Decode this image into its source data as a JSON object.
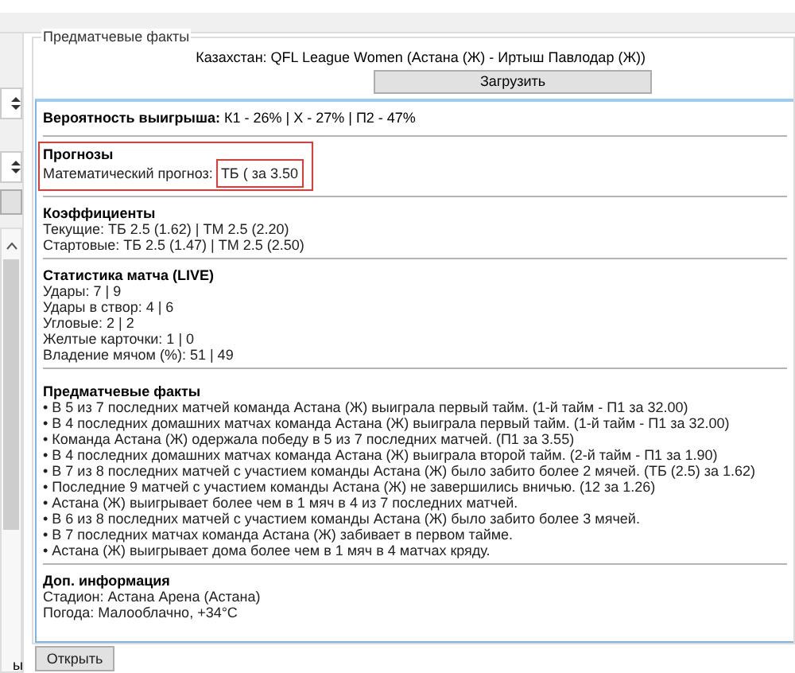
{
  "group_title": "Предматчевые факты",
  "match_title": "Казахстан: QFL League Women (Астана (Ж) - Иртыш Павлодар (Ж))",
  "load_button": "Загрузить",
  "sections": [
    {
      "kind": "inline",
      "text": "**Вероятность выигрыша:** К1 - 26% | Х - 27% | П2 - 47%"
    },
    {
      "kind": "forecast",
      "title": "Прогнозы",
      "label": "Математический прогноз:",
      "value": "ТБ ( за 3.50",
      "highlighted": true
    },
    {
      "kind": "block",
      "title": "Коэффициенты",
      "lines": [
        "Текущие: ТБ 2.5 (1.62) | ТМ 2.5 (2.20)",
        "Стартовые: ТБ 2.5 (1.47) | ТМ 2.5 (2.50)"
      ]
    },
    {
      "kind": "block",
      "title": "Статистика матча (LIVE)",
      "lines": [
        "Удары: 7 | 9",
        "Удары в створ: 4 | 6",
        "Угловые: 2 | 2",
        "Желтые карточки: 1 | 0",
        "Владение мячом (%): 51 | 49"
      ]
    },
    {
      "kind": "block",
      "title": "Предматчевые факты",
      "lines": [
        "• В 5 из 7 последних матчей команда Астана (Ж) выиграла первый тайм. (1-й тайм - П1 за 32.00)",
        "• В 4 последних домашних матчах команда Астана (Ж) выиграла первый тайм. (1-й тайм - П1 за 32.00)",
        "• Команда Астана (Ж) одержала победу в 5 из 7 последних матчей. (П1 за 3.55)",
        "• В 4 последних домашних матчах команда Астана (Ж) выиграла второй тайм. (2-й тайм - П1 за 1.90)",
        "• В 7 из 8 последних матчей с участием команды Астана (Ж) было забито более 2 мячей. (ТБ (2.5) за 1.62)",
        "• Последние 9 матчей с участием команды Астана (Ж) не завершились вничью. (12 за 1.26)",
        "• Астана (Ж) выигрывает более чем в 1 мяч в 4 из 7 последних матчей.",
        "• В 6 из 8 последних матчей с участием команды Астана (Ж) было забито более 3 мячей.",
        "• В 7 последних матчах команда Астана (Ж) забивает в первом тайме.",
        "• Астана (Ж) выигрывает дома более чем в 1 мяч в 4 матчах кряду."
      ]
    },
    {
      "kind": "block",
      "title": "Доп. информация",
      "lines": [
        "Стадион: Астана Арена (Астана)",
        "Погода: Малооблачно, +34°C"
      ]
    }
  ],
  "open_button": "Открыть",
  "left_cut_text": "ы"
}
